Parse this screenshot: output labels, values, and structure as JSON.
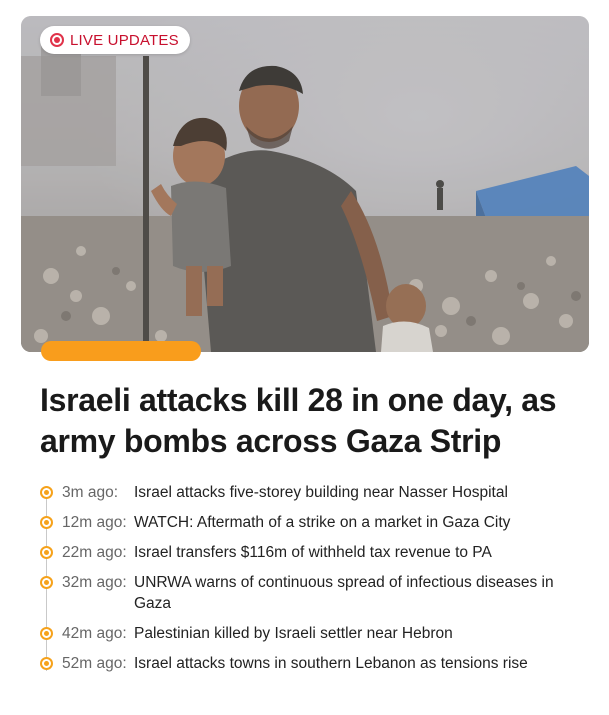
{
  "live_badge": {
    "label": "LIVE UPDATES",
    "color": "#c8102e"
  },
  "hero_image": {
    "description_name": "gaza-rubble-photo"
  },
  "accent_color": "#f99d1c",
  "headline": "Israeli attacks kill 28 in one day, as army bombs across Gaza Strip",
  "updates": [
    {
      "time": "3m ago:",
      "text": "Israel attacks five-storey building near Nasser Hospital"
    },
    {
      "time": "12m ago:",
      "text": "WATCH: Aftermath of a strike on a market in Gaza City"
    },
    {
      "time": "22m ago:",
      "text": "Israel transfers $116m of withheld tax revenue to PA"
    },
    {
      "time": "32m ago:",
      "text": "UNRWA warns of continuous spread of infectious diseases in Gaza"
    },
    {
      "time": "42m ago:",
      "text": "Palestinian killed by Israeli settler near Hebron"
    },
    {
      "time": "52m ago:",
      "text": "Israel attacks towns in southern Lebanon as tensions rise"
    }
  ]
}
